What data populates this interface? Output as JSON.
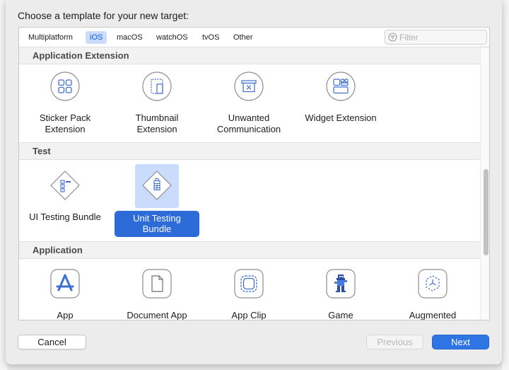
{
  "dialog": {
    "prompt": "Choose a template for your new target:"
  },
  "tabs": [
    {
      "label": "Multiplatform",
      "active": false
    },
    {
      "label": "iOS",
      "active": true
    },
    {
      "label": "macOS",
      "active": false
    },
    {
      "label": "watchOS",
      "active": false
    },
    {
      "label": "tvOS",
      "active": false
    },
    {
      "label": "Other",
      "active": false
    }
  ],
  "filter": {
    "placeholder": "Filter",
    "value": ""
  },
  "sections": [
    {
      "title": "Application Extension",
      "items": [
        {
          "label_line1": "Sticker Pack",
          "label_line2": "Extension",
          "icon": "sticker-pack-icon"
        },
        {
          "label_line1": "Thumbnail",
          "label_line2": "Extension",
          "icon": "thumbnail-icon"
        },
        {
          "label_line1": "Unwanted",
          "label_line2": "Communication",
          "icon": "unwanted-communication-icon"
        },
        {
          "label_line1": "Widget Extension",
          "label_line2": "",
          "icon": "widget-icon"
        }
      ]
    },
    {
      "title": "Test",
      "items": [
        {
          "label_line1": "UI Testing Bundle",
          "label_line2": "",
          "icon": "ui-testing-icon",
          "selected": false
        },
        {
          "label_line1": "Unit Testing",
          "label_line2": "Bundle",
          "icon": "unit-testing-icon",
          "selected": true
        }
      ]
    },
    {
      "title": "Application",
      "items": [
        {
          "label_line1": "App",
          "icon": "app-store-icon"
        },
        {
          "label_line1": "Document App",
          "icon": "document-icon"
        },
        {
          "label_line1": "App Clip",
          "icon": "app-clip-icon"
        },
        {
          "label_line1": "Game",
          "icon": "game-icon"
        },
        {
          "label_line1": "Augmented",
          "icon": "augmented-reality-icon"
        }
      ]
    }
  ],
  "buttons": {
    "cancel": "Cancel",
    "previous": "Previous",
    "next": "Next"
  },
  "colors": {
    "accent": "#2f74e3",
    "selection": "#2c6bd8",
    "icon_blue": "#3f6fd0"
  }
}
